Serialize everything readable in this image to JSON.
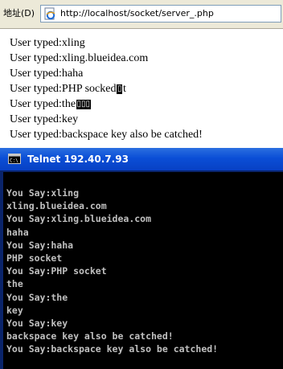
{
  "address_bar": {
    "label": "地址(D)",
    "url": "http://localhost/socket/server_.php"
  },
  "browser": {
    "lines": [
      "User typed:xling",
      "User typed:xling.blueidea.com",
      "User typed:haha",
      "User typed:PHP socked",
      "User typed:the",
      "User typed:key",
      "User typed:backspace key also be catched!"
    ],
    "line4_garbled": "▯",
    "line4_suffix": "t",
    "line5_garbled": "▯▯▯"
  },
  "telnet": {
    "title": "Telnet 192.40.7.93",
    "console_lines": [
      "You Say:xling",
      "xling.blueidea.com",
      "You Say:xling.blueidea.com",
      "haha",
      "You Say:haha",
      "PHP socket",
      "You Say:PHP socket",
      "the",
      "You Say:the",
      "key",
      "You Say:key",
      "backspace key also be catched!",
      "You Say:backspace key also be catched!"
    ]
  },
  "icons": {
    "browser_icon": "ie-page-icon",
    "telnet_icon": "cmd-icon"
  },
  "colors": {
    "titlebar": "#0a4ed6",
    "console_bg": "#000000",
    "console_text": "#c0c0c0",
    "toolbar_bg": "#ece9d8"
  }
}
